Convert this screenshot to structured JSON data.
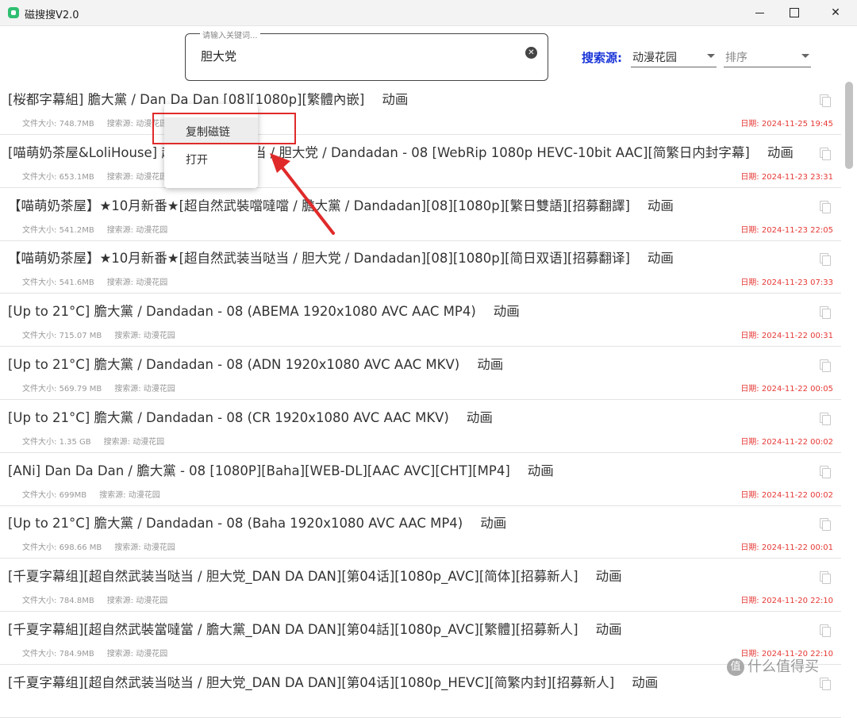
{
  "window": {
    "title": "磁搜搜V2.0"
  },
  "search": {
    "legend": "请输入关键词...",
    "value": "胆大党"
  },
  "filters": {
    "source_label": "搜索源:",
    "source_value": "动漫花园",
    "sort_placeholder": "排序"
  },
  "labels": {
    "size_prefix": "文件大小: ",
    "source_prefix": "搜索源: ",
    "date_prefix": "日期: "
  },
  "results": [
    {
      "title": "[桜都字幕組] 膽大黨 / Dan Da Dan [08][1080p][繁體內嵌]",
      "category": "动画",
      "size": "748.7MB",
      "source": "动漫花园",
      "date": "2024-11-25 19:45"
    },
    {
      "title": "[喵萌奶茶屋&LoliHouse] 超自然武装当哒当 / 胆大党 / Dandadan - 08 [WebRip 1080p HEVC-10bit AAC][简繁日内封字幕]",
      "category": "动画",
      "size": "653.1MB",
      "source": "动漫花园",
      "date": "2024-11-23 23:31"
    },
    {
      "title": "【喵萌奶茶屋】★10月新番★[超自然武裝噹噠噹 / 膽大黨 / Dandadan][08][1080p][繁日雙語][招募翻譯]",
      "category": "动画",
      "size": "541.2MB",
      "source": "动漫花园",
      "date": "2024-11-23 22:05"
    },
    {
      "title": "【喵萌奶茶屋】★10月新番★[超自然武装当哒当 / 胆大党 / Dandadan][08][1080p][简日双语][招募翻译]",
      "category": "动画",
      "size": "541.6MB",
      "source": "动漫花园",
      "date": "2024-11-23 07:33"
    },
    {
      "title": "[Up to 21°C] 膽大黨 / Dandadan - 08 (ABEMA 1920x1080 AVC AAC MP4)",
      "category": "动画",
      "size": "715.07 MB",
      "source": "动漫花园",
      "date": "2024-11-22 00:31"
    },
    {
      "title": "[Up to 21°C] 膽大黨 / Dandadan - 08 (ADN 1920x1080 AVC AAC MKV)",
      "category": "动画",
      "size": "569.79 MB",
      "source": "动漫花园",
      "date": "2024-11-22 00:05"
    },
    {
      "title": "[Up to 21°C] 膽大黨 / Dandadan - 08 (CR 1920x1080 AVC AAC MKV)",
      "category": "动画",
      "size": "1.35 GB",
      "source": "动漫花园",
      "date": "2024-11-22 00:02"
    },
    {
      "title": "[ANi] Dan Da Dan /  膽大黨 - 08 [1080P][Baha][WEB-DL][AAC AVC][CHT][MP4]",
      "category": "动画",
      "size": "699MB",
      "source": "动漫花园",
      "date": "2024-11-22 00:02"
    },
    {
      "title": "[Up to 21°C] 膽大黨 / Dandadan - 08 (Baha 1920x1080 AVC AAC MP4)",
      "category": "动画",
      "size": "698.66 MB",
      "source": "动漫花园",
      "date": "2024-11-22 00:01"
    },
    {
      "title": "[千夏字幕组][超自然武装当哒当 / 胆大党_DAN DA DAN][第04话][1080p_AVC][简体][招募新人]",
      "category": "动画",
      "size": "784.8MB",
      "source": "动漫花园",
      "date": "2024-11-20 22:10"
    },
    {
      "title": "[千夏字幕組][超自然武裝當噠當 / 膽大黨_DAN DA DAN][第04話][1080p_AVC][繁體][招募新人]",
      "category": "动画",
      "size": "784.9MB",
      "source": "动漫花园",
      "date": "2024-11-20 22:10"
    },
    {
      "title": "[千夏字幕组][超自然武装当哒当 / 胆大党_DAN DA DAN][第04话][1080p_HEVC][简繁内封][招募新人]",
      "category": "动画",
      "size": "",
      "source": "",
      "date": ""
    }
  ],
  "context_menu": {
    "copy_magnet": "复制磁链",
    "open": "打开"
  },
  "watermark": {
    "badge": "值",
    "text": "什么值得买"
  },
  "colors": {
    "accent_blue": "#1a35d8",
    "date_red": "#e53935",
    "annotation_red": "#e02a2a"
  }
}
